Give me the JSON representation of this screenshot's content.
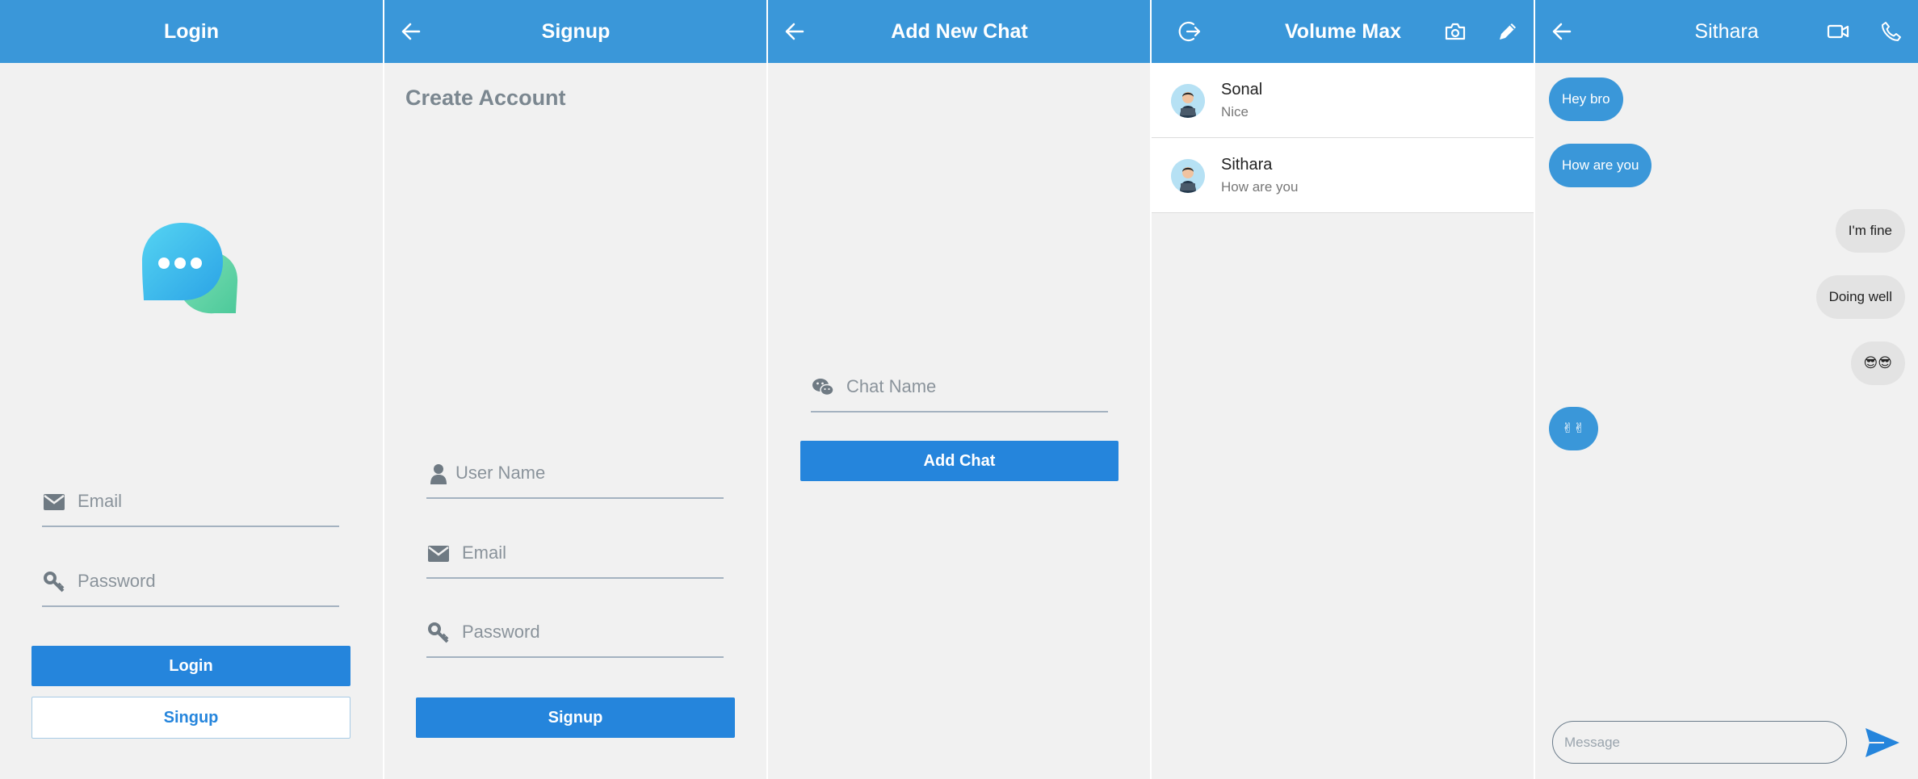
{
  "colors": {
    "app_bar": "#3a97d9",
    "primary_button": "#2585dc",
    "background": "#f1f1f1",
    "bubble_incoming": "#3a97d9",
    "bubble_outgoing": "#e3e3e3"
  },
  "login": {
    "title": "Login",
    "logo_icon": "chat-bubbles-logo-icon",
    "email_placeholder": "Email",
    "password_placeholder": "Password",
    "login_button": "Login",
    "signup_button": "Singup"
  },
  "signup": {
    "title": "Signup",
    "back_icon": "arrow-left-icon",
    "heading": "Create Account",
    "username_placeholder": "User Name",
    "email_placeholder": "Email",
    "password_placeholder": "Password",
    "signup_button": "Signup"
  },
  "add_chat": {
    "title": "Add New Chat",
    "back_icon": "arrow-left-icon",
    "chat_name_placeholder": "Chat Name",
    "add_button": "Add Chat"
  },
  "chat_list": {
    "title": "Volume Max",
    "icons": [
      "logout-icon",
      "camera-icon",
      "pencil-icon"
    ],
    "chats": [
      {
        "name": "Sonal",
        "last_message": "Nice"
      },
      {
        "name": "Sithara",
        "last_message": "How are you"
      }
    ]
  },
  "conversation": {
    "title": "Sithara",
    "icons": [
      "arrow-left-icon",
      "video-camera-icon",
      "phone-icon"
    ],
    "messages": [
      {
        "text": "Hey bro",
        "direction": "incoming"
      },
      {
        "text": "How are you",
        "direction": "incoming"
      },
      {
        "text": "I'm fine",
        "direction": "outgoing"
      },
      {
        "text": "Doing well",
        "direction": "outgoing"
      },
      {
        "text": "😎😎",
        "direction": "outgoing"
      },
      {
        "text": "✌✌",
        "direction": "incoming"
      }
    ],
    "message_placeholder": "Message",
    "send_icon": "send-icon"
  }
}
